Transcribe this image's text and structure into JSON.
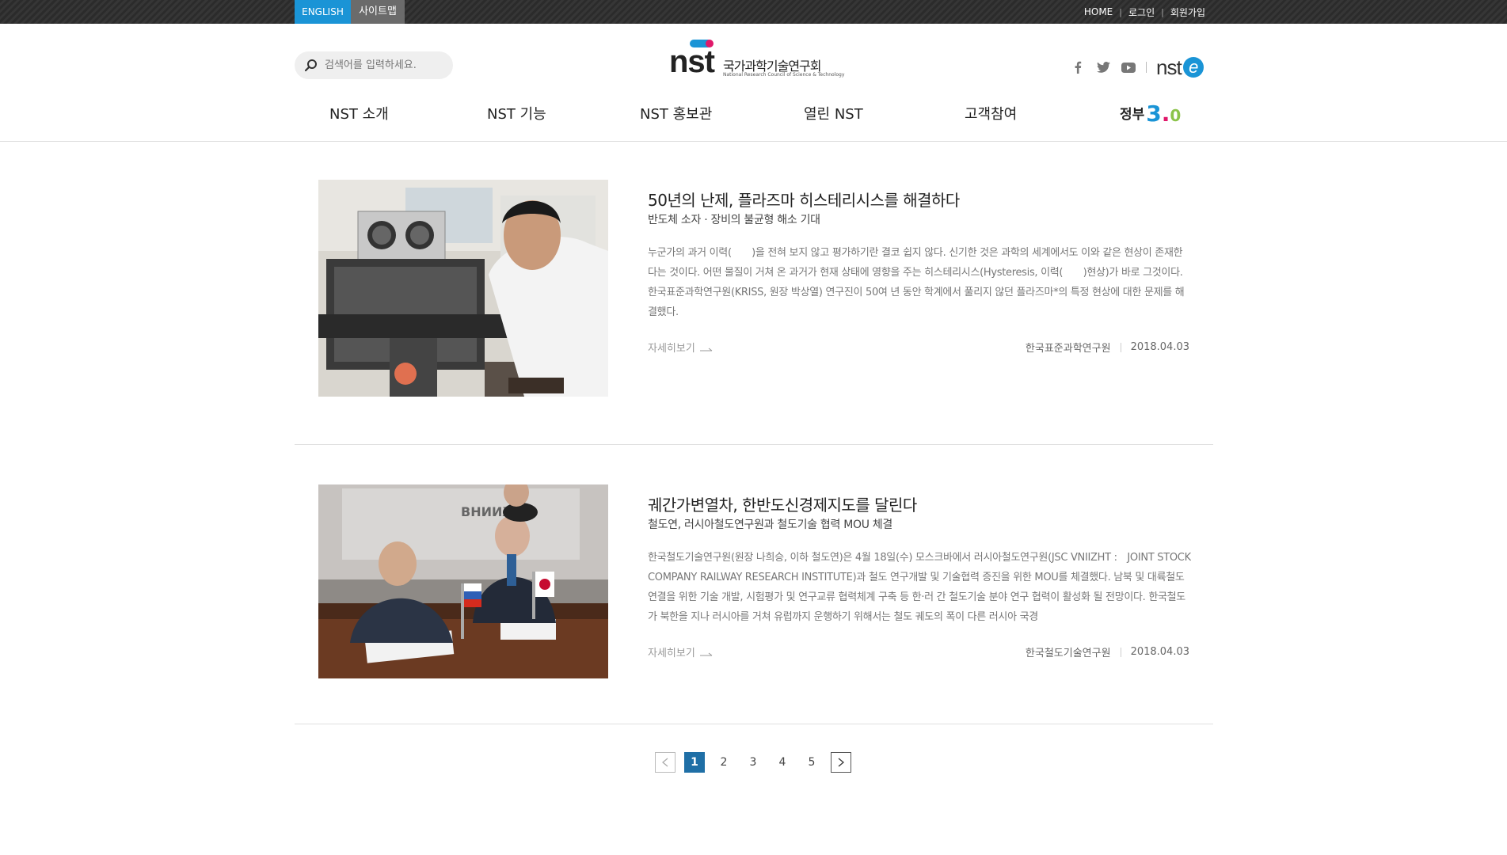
{
  "topbar": {
    "english": "ENGLISH",
    "sitemap": "사이트맵",
    "home": "HOME",
    "login": "로그인",
    "signup": "회원가입"
  },
  "search": {
    "placeholder": "검색어를 입력하세요."
  },
  "logo": {
    "mark": "nst",
    "name_ko": "국가과학기술연구회",
    "name_en": "National Research Council of Science & Technology"
  },
  "social": {
    "icons": [
      "facebook-icon",
      "twitter-icon",
      "youtube-icon"
    ],
    "nste_label": "nst",
    "nste_e": "e"
  },
  "nav": {
    "items": [
      "NST 소개",
      "NST 기능",
      "NST 홍보관",
      "열린 NST",
      "고객참여"
    ],
    "gov_label": "정부",
    "gov_num_3": "3",
    "gov_num_dot": ".",
    "gov_num_0": "0"
  },
  "articles": [
    {
      "title": "50년의 난제, 플라즈마 히스테리시스를 해결하다",
      "subtitle": "반도체 소자 · 장비의 불균형 해소 기대",
      "body": "누군가의 과거 이력(　　)을 전혀 보지 않고 평가하기란 결코 쉽지 않다. 신기한 것은 과학의 세계에서도 이와 같은 현상이 존재한다는 것이다. 어떤 물질이 거쳐 온 과거가 현재 상태에 영향을 주는 히스테리시스(Hysteresis, 이력(　　)현상)가 바로 그것이다. 한국표준과학연구원(KRISS, 원장 박상열) 연구진이 50여 년 동안 학계에서 풀리지 않던 플라즈마*의 특정 현상에 대한 문제를 해결했다.",
      "more": "자세히보기",
      "org": "한국표준과학연구원",
      "date": "2018.04.03"
    },
    {
      "title": "궤간가변열차, 한반도신경제지도를 달린다",
      "subtitle": "철도연, 러시아철도연구원과 철도기술 협력 MOU 체결",
      "body": "한국철도기술연구원(원장 나희승, 이하 철도연)은 4월 18일(수) 모스크바에서 러시아철도연구원(JSC VNIIZHT :　JOINT STOCK COMPANY RAILWAY RESEARCH INSTITUTE)과 철도 연구개발 및 기술협력 증진을 위한 MOU를 체결했다. 남북 및 대륙철도 연결을 위한 기술 개발, 시험평가 및 연구교류 협력체계 구축 등 한·러 간 철도기술 분야 연구 협력이 활성화 될 전망이다. 한국철도가 북한을 지나 러시아를 거쳐 유럽까지 운행하기 위해서는 철도 궤도의 폭이 다른 러시아 국경",
      "more": "자세히보기",
      "org": "한국철도기술연구원",
      "date": "2018.04.03"
    }
  ],
  "pagination": {
    "pages": [
      "1",
      "2",
      "3",
      "4",
      "5"
    ],
    "current": "1"
  },
  "colors": {
    "accent_blue": "#1a94d6",
    "accent_pink": "#e0186a",
    "pager_active": "#1f6fa6"
  }
}
